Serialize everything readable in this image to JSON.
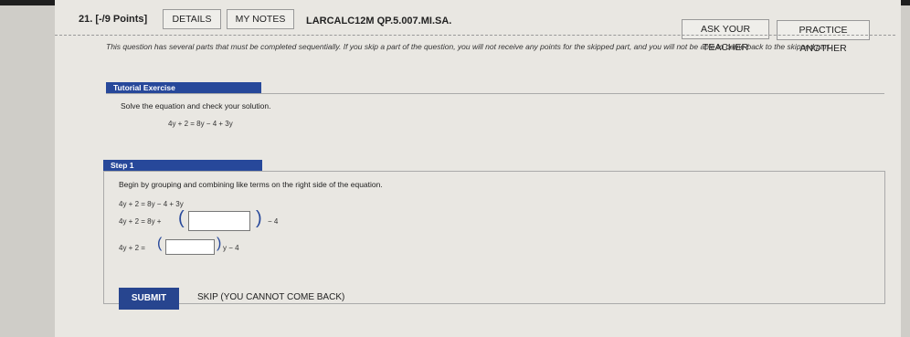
{
  "question": {
    "number": "21. [-/9 Points]",
    "details_label": "DETAILS",
    "notes_label": "MY NOTES",
    "id": "LARCALC12M QP.5.007.MI.SA.",
    "ask_teacher_label": "ASK YOUR TEACHER",
    "practice_label": "PRACTICE ANOTHER",
    "instructions": "This question has several parts that must be completed sequentially. If you skip a part of the question, you will not receive any points for the skipped part, and you will not be able to come back to the skipped part."
  },
  "tutorial": {
    "header": "Tutorial Exercise",
    "prompt": "Solve the equation and check your solution.",
    "equation": "4y + 2 = 8y − 4 + 3y"
  },
  "step1": {
    "header": "Step 1",
    "prompt": "Begin by grouping and combining like terms on the right side of the equation.",
    "line1": "4y + 2 = 8y − 4 + 3y",
    "line2_left": "4y + 2 = 8y +",
    "line2_right": "− 4",
    "line3_left": "4y + 2 =",
    "line3_right": "y − 4",
    "answer1_value": "",
    "answer2_value": ""
  },
  "actions": {
    "submit_label": "SUBMIT",
    "skip_label": "SKIP (YOU CANNOT COME BACK)"
  },
  "colors": {
    "accent": "#27489a"
  }
}
